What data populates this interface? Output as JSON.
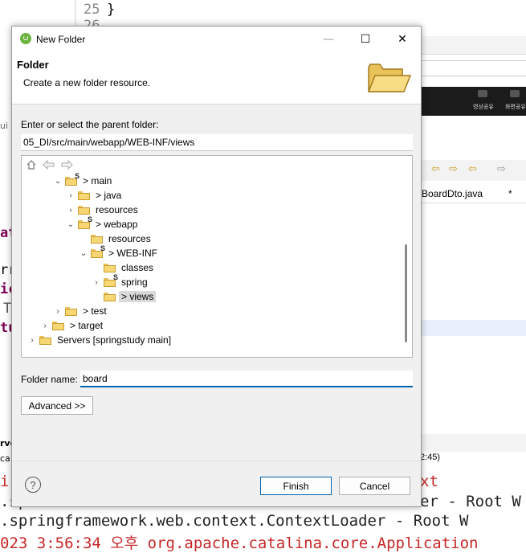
{
  "background": {
    "editor": {
      "line_numbers": [
        "25",
        "26"
      ],
      "code_line_25": "}",
      "right_tabs": {
        "tab1": "BoardDto.java",
        "tab2": "*"
      },
      "video_labels": [
        "영상공유",
        "화면공유"
      ],
      "left_fragments": [
        "ui",
        "at",
        "rr",
        "ic",
        "T",
        "tu",
        "rve",
        "ca"
      ],
      "time_fragment": "2:45)"
    },
    "console": {
      "line1": "i",
      "line1_right": "xt",
      "line2": ".sp",
      "line2_right": "er - Root W",
      "line3": ".springframework.web.context.ContextLoader - Root W",
      "line4": "023 3:56:34 오후 org.apache.catalina.core.Application"
    }
  },
  "dialog": {
    "title": "New Folder",
    "window_controls": {
      "minimize": "—",
      "maximize": "☐",
      "close": "✕"
    },
    "banner": {
      "heading": "Folder",
      "description": "Create a new folder resource.",
      "icon": "open-folder-icon"
    },
    "parent_label": "Enter or select the parent folder:",
    "parent_path": "05_DI/src/main/webapp/WEB-INF/views",
    "tree_toolbar": {
      "home": "home-icon",
      "back": "back-arrow-icon",
      "forward": "forward-arrow-icon"
    },
    "tree": [
      {
        "label": "> main",
        "chevron": "v",
        "depth": 0,
        "pkg": true
      },
      {
        "label": "> java",
        "chevron": ">",
        "depth": 1,
        "pkg": false
      },
      {
        "label": "resources",
        "chevron": ">",
        "depth": 1,
        "pkg": false
      },
      {
        "label": "> webapp",
        "chevron": "v",
        "depth": 1,
        "pkg": true
      },
      {
        "label": "resources",
        "chevron": "",
        "depth": 2,
        "pkg": false
      },
      {
        "label": "> WEB-INF",
        "chevron": "v",
        "depth": 2,
        "pkg": true
      },
      {
        "label": "classes",
        "chevron": "",
        "depth": 3,
        "pkg": false
      },
      {
        "label": "spring",
        "chevron": ">",
        "depth": 3,
        "pkg": true
      },
      {
        "label": "> views",
        "chevron": "",
        "depth": 3,
        "pkg": false,
        "selected": true
      },
      {
        "label": "> test",
        "chevron": ">",
        "depth": 0,
        "pkg": false
      },
      {
        "label": "> target",
        "chevron": ">",
        "depth": -1,
        "pkg": false
      },
      {
        "label": "Servers [springstudy main]",
        "chevron": ">",
        "depth": -2,
        "pkg": false
      }
    ],
    "folder_name_label": "Folder name:",
    "folder_name_value": "board",
    "advanced_button": "Advanced >>",
    "help_icon": "?",
    "finish_button": "Finish",
    "cancel_button": "Cancel",
    "colors": {
      "accent": "#0063b1",
      "selected_row": "#d9d9d9",
      "console_red": "#c62828"
    }
  }
}
